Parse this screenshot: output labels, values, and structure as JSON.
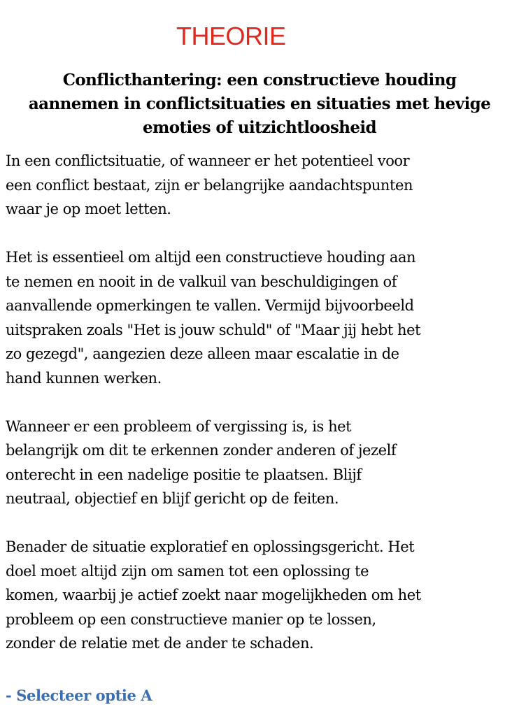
{
  "heading": "THEORIE",
  "title_lines": [
    "Conflicthantering: een constructieve houding",
    "aannemen in conflictsituaties en situaties met hevige",
    "emoties of uitzichtloosheid"
  ],
  "paragraphs": [
    [
      "In een conflictsituatie, of wanneer er het potentieel voor",
      "een conflict bestaat, zijn er belangrijke aandachtspunten",
      "waar je op moet letten."
    ],
    [
      "Het is essentieel om altijd een constructieve houding aan",
      "te nemen en nooit in de valkuil van beschuldigingen of",
      "aanvallende opmerkingen te vallen. Vermijd bijvoorbeeld",
      "uitspraken zoals \"Het is jouw schuld\" of \"Maar jij hebt het",
      "zo gezegd\", aangezien deze alleen maar escalatie in de",
      "hand kunnen werken."
    ],
    [
      "Wanneer er een probleem of vergissing is, is het",
      "belangrijk om dit te erkennen zonder anderen of jezelf",
      "onterecht in een nadelige positie te plaatsen. Blijf",
      "neutraal, objectief en blijf gericht op de feiten."
    ],
    [
      "Benader de situatie exploratief en oplossingsgericht. Het",
      "doel moet altijd zijn om samen tot een oplossing te",
      "komen, waarbij je actief zoekt naar mogelijkheden om het",
      "probleem op een constructieve manier op te lossen,",
      "zonder de relatie met de ander te schaden."
    ]
  ],
  "cta": "- Selecteer optie A",
  "colors": {
    "heading": "#e0281f",
    "cta": "#3a6fb4",
    "text": "#000000",
    "background": "#ffffff"
  }
}
